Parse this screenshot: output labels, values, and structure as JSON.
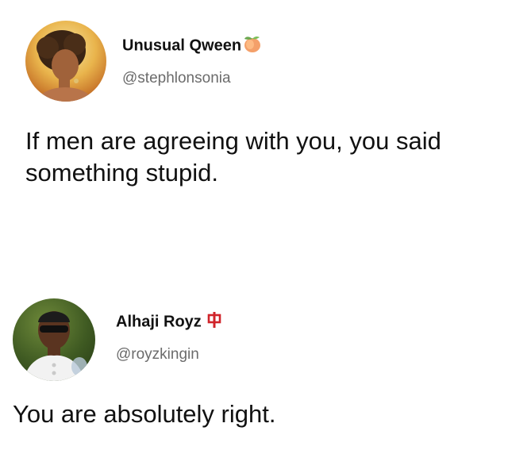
{
  "tweets": [
    {
      "display_name": "Unusual Qween",
      "handle": "@stephlonsonia",
      "badge_icon": "peach-emoji-icon",
      "text": "If men are agreeing with you, you said something stupid."
    },
    {
      "display_name": "Alhaji Royz",
      "handle": "@royzkingin",
      "badge_icon": "mahjong-red-dragon-icon",
      "text": "You are absolutely right."
    }
  ]
}
